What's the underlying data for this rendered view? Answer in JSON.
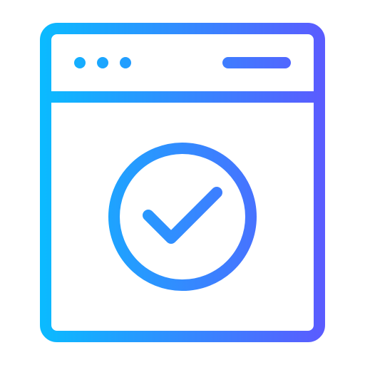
{
  "icon": {
    "name": "browser-window-check-icon",
    "gradient": {
      "start": "#0ABBFF",
      "end": "#5B5BFF"
    }
  }
}
